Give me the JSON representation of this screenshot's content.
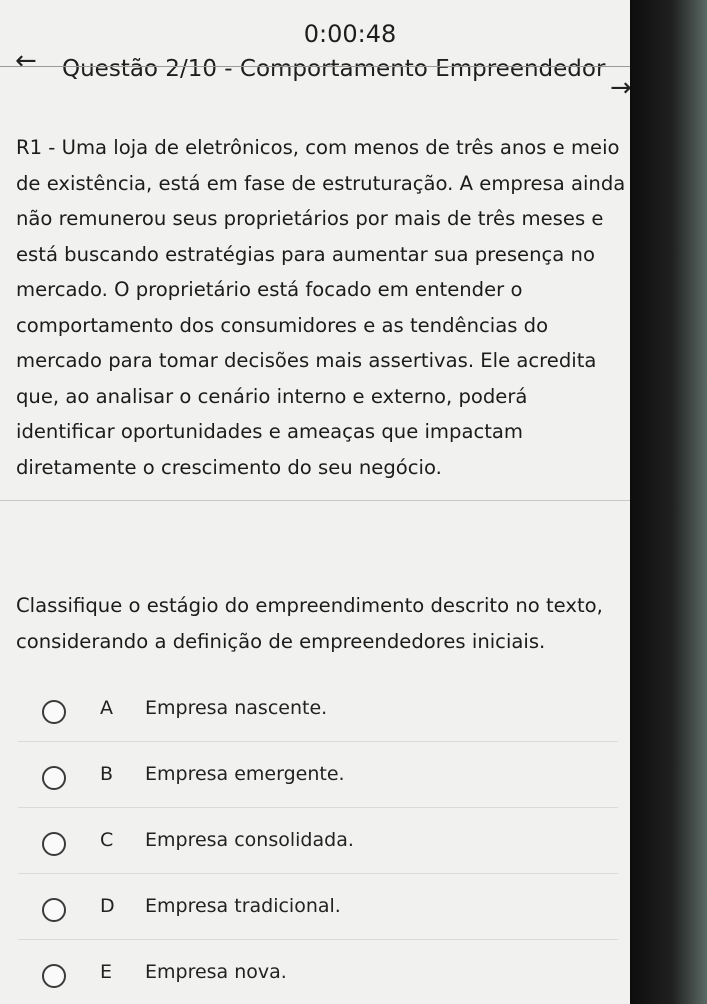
{
  "timer": "0:00:48",
  "header": {
    "back_icon": "arrow-left-icon",
    "title": "Questão 2/10 - Comportamento Empreendedor",
    "next_icon": "arrow-right-icon"
  },
  "question": {
    "statement": "R1 - Uma loja de eletrônicos, com menos de três anos e meio de existência, está em fase de estruturação. A empresa ainda não remunerou seus proprietários por mais de três meses e está buscando estratégias para aumentar sua presença no mercado. O proprietário está focado em entender o comportamento dos consumidores e as tendências do mercado para tomar decisões mais assertivas. Ele acredita que, ao analisar o cenário interno e externo, poderá identificar oportunidades e ameaças que impactam diretamente o crescimento do seu negócio.",
    "prompt": "Classifique o estágio do empreendimento descrito no texto, considerando a definição de empreendedores iniciais."
  },
  "options": [
    {
      "letter": "A",
      "text": "Empresa nascente."
    },
    {
      "letter": "B",
      "text": "Empresa emergente."
    },
    {
      "letter": "C",
      "text": "Empresa consolidada."
    },
    {
      "letter": "D",
      "text": "Empresa tradicional."
    },
    {
      "letter": "E",
      "text": "Empresa nova."
    }
  ]
}
